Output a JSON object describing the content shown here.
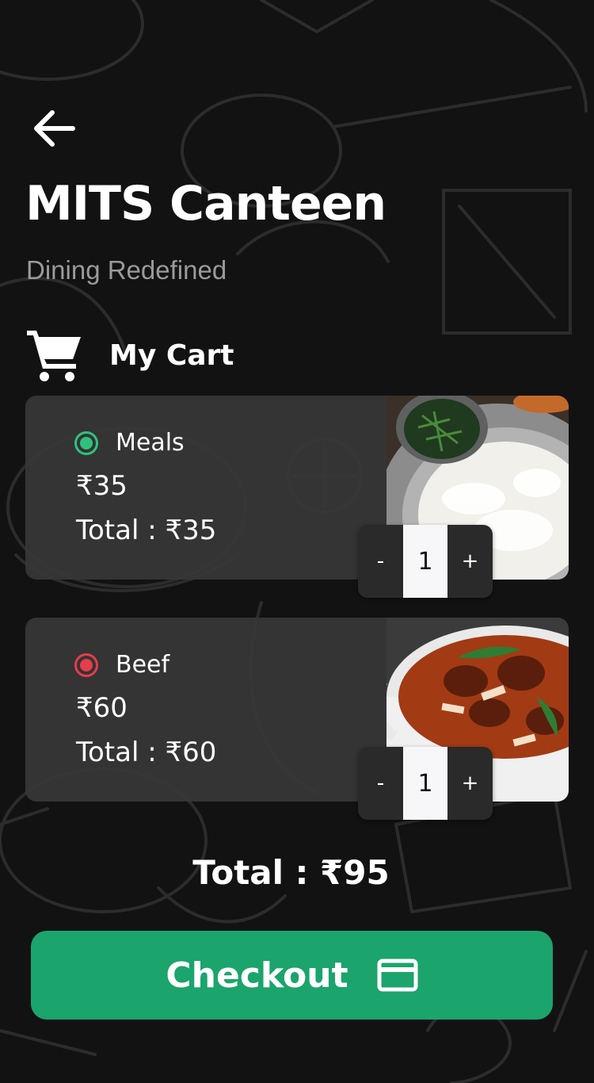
{
  "header": {
    "title": "MITS Canteen",
    "subtitle": "Dining Redefined",
    "back_icon": "arrow-left-icon"
  },
  "cart": {
    "title": "My Cart",
    "icon": "shopping-cart-icon",
    "items": [
      {
        "name": "Meals",
        "price": "₹35",
        "total": "Total : ₹35",
        "quantity": "1",
        "decrement_label": "-",
        "increment_label": "+",
        "type": "veg",
        "indicator_color": "#2ec27e",
        "image": "meals-plate-image"
      },
      {
        "name": "Beef",
        "price": "₹60",
        "total": "Total : ₹60",
        "quantity": "1",
        "decrement_label": "-",
        "increment_label": "+",
        "type": "non-veg",
        "indicator_color": "#e43d4b",
        "image": "beef-curry-image"
      }
    ]
  },
  "summary": {
    "total": "Total : ₹95"
  },
  "checkout": {
    "label": "Checkout",
    "icon": "credit-card-icon",
    "color": "#1ba46c"
  },
  "colors": {
    "background": "#121212",
    "card": "#373737",
    "accent": "#1ba46c"
  }
}
